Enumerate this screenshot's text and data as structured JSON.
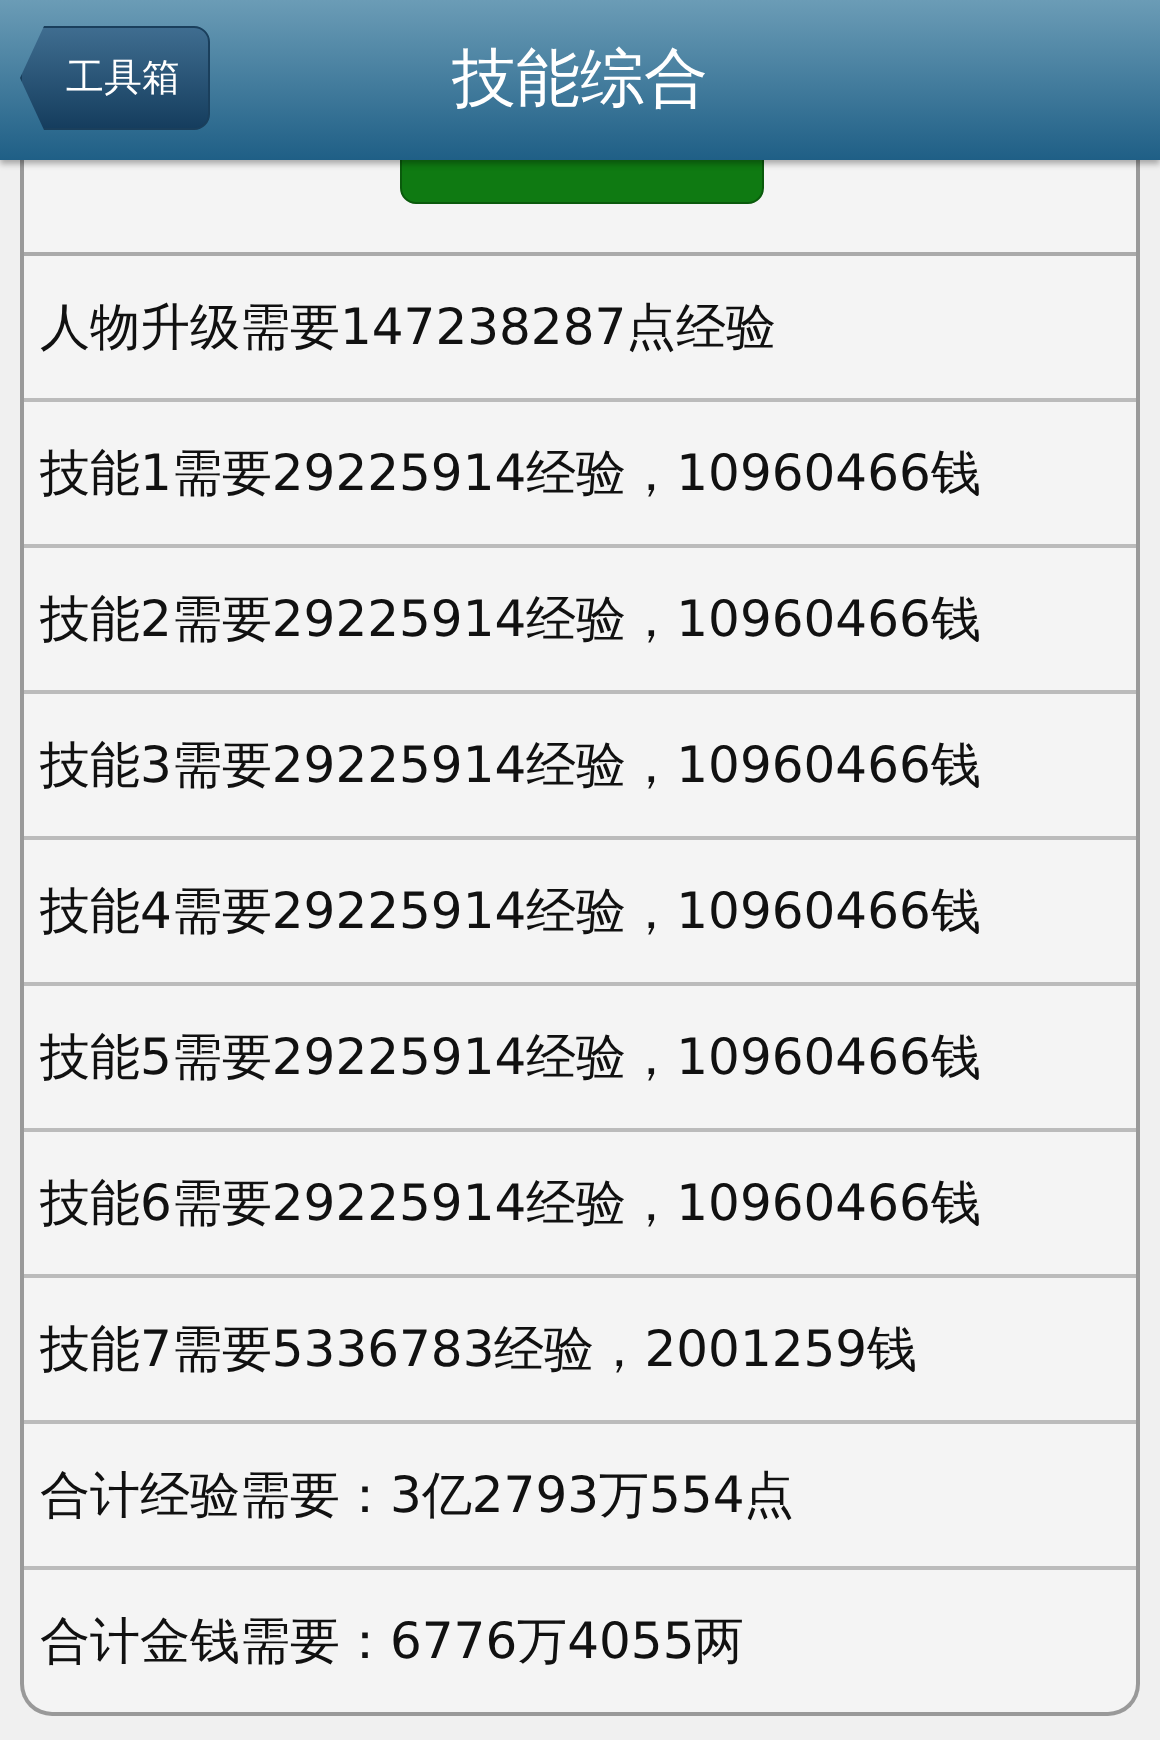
{
  "nav_bar": {
    "back_button": "工具箱",
    "title": "技能综合"
  },
  "rows": [
    {
      "text": "人物升级需要147238287点经验"
    },
    {
      "text": "技能1需要29225914经验，10960466钱"
    },
    {
      "text": "技能2需要29225914经验，10960466钱"
    },
    {
      "text": "技能3需要29225914经验，10960466钱"
    },
    {
      "text": "技能4需要29225914经验，10960466钱"
    },
    {
      "text": "技能5需要29225914经验，10960466钱"
    },
    {
      "text": "技能6需要29225914经验，10960466钱"
    },
    {
      "text": "技能7需要5336783经验，2001259钱"
    },
    {
      "text": "合计经验需要：3亿2793万554点"
    },
    {
      "text": "合计金钱需要：6776万4055两"
    }
  ]
}
